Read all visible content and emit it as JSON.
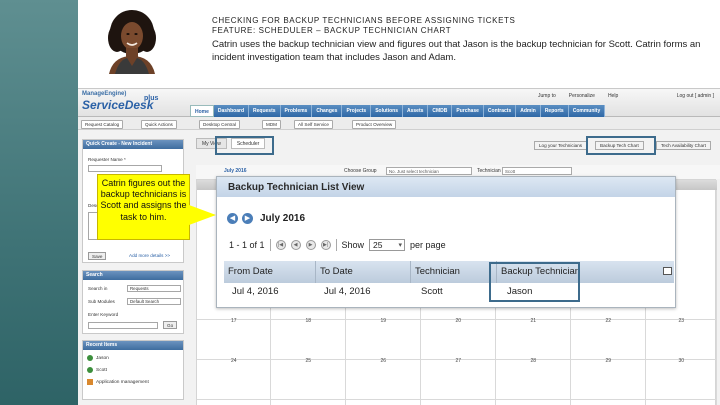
{
  "slide": {
    "line1": "CHECKING FOR BACKUP TECHNICIANS BEFORE ASSIGNING TICKETS",
    "line2": "FEATURE: SCHEDULER – BACKUP TECHNICIAN CHART",
    "description": "Catrin uses the backup technician view and figures out that Jason is the backup technician for Scott. Catrin forms an incident investigation team that includes Jason and Adam.",
    "callout": "Catrin figures out the backup technicians is Scott and assigns the task to him."
  },
  "app": {
    "logo_top": "ManageEngine)",
    "logo_main": "ServiceDesk",
    "logo_version": "plus",
    "top_links": [
      "Jump to",
      "Personalize",
      "Help"
    ],
    "logout": "Log out [ admin ]",
    "tabs": [
      "Home",
      "Dashboard",
      "Requests",
      "Problems",
      "Changes",
      "Projects",
      "Solutions",
      "Assets",
      "CMDB",
      "Purchase",
      "Contracts",
      "Admin",
      "Reports",
      "Community"
    ],
    "active_tab": "Home",
    "toolbar": [
      "Request Catalog",
      "Quick Actions",
      "Desktop Central",
      "MDM",
      "All Self Service",
      "Product Overview"
    ]
  },
  "left_panel": {
    "quick_create_title": "Quick Create - New Incident",
    "requester_label": "Requester Name *",
    "desc_label": "Desc",
    "save_button": "Save",
    "add_more_link": "Add more details >>",
    "search_title": "Search",
    "search_in_label": "Search in",
    "search_in_value": "Requests",
    "sub_module_label": "Sub Modules",
    "sub_module_value": "Default Search",
    "keyword_label": "Enter Keyword",
    "go_button": "Go",
    "recent_title": "Recent Items",
    "recent_items": [
      "Jason",
      "Scott",
      "Application management"
    ]
  },
  "main": {
    "view_tabs": [
      "My View",
      "Scheduler"
    ],
    "active_view_tab": "Scheduler",
    "right_buttons": [
      "Log your Technicians",
      "Backup Tech Chart",
      "Tech Availability Chart"
    ],
    "month": "July 2016",
    "choose_group_label": "Choose Group",
    "choose_group_value": "No. Just select technician",
    "technician_label": "Technician",
    "technician_value": "Scott",
    "week_days": [
      "17",
      "18",
      "19",
      "20",
      "21",
      "22",
      "23",
      "24",
      "25",
      "26",
      "27",
      "28",
      "29",
      "30",
      "31"
    ]
  },
  "popup": {
    "title": "Backup Technician List View",
    "month": "July 2016",
    "range_text": "1 - 1 of 1",
    "show_label": "Show",
    "per_page_value": "25",
    "per_page_label": "per page",
    "columns": [
      "From Date",
      "To Date",
      "Technician",
      "Backup Technician"
    ],
    "rows": [
      {
        "from": "Jul 4, 2016",
        "to": "Jul 4, 2016",
        "technician": "Scott",
        "backup": "Jason"
      }
    ]
  },
  "colors": {
    "band": "#3f7376",
    "callout": "#ffff00",
    "highlight": "#3d6b8c",
    "tab_blue": "#2f68a6"
  }
}
